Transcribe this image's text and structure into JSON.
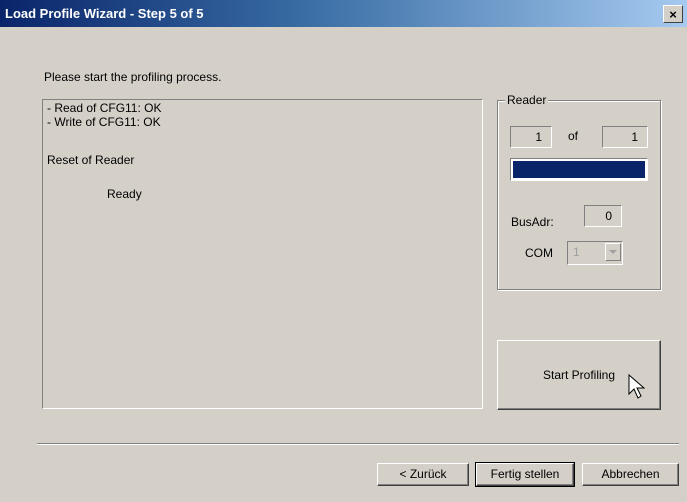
{
  "window": {
    "title": "Load Profile Wizard - Step 5 of 5",
    "close_glyph": "×"
  },
  "instruction": "Please start the profiling process.",
  "log": [
    "- Read of CFG11: OK",
    "- Write of CFG11: OK",
    "Reset of Reader",
    "Ready"
  ],
  "reader": {
    "label": "Reader",
    "current": "1",
    "of_label": "of",
    "total": "1",
    "progress_percent": 100,
    "busadr_label": "BusAdr:",
    "busadr_value": "0",
    "com_label": "COM",
    "com_value": "1"
  },
  "start_button": "Start Profiling",
  "footer": {
    "back": "< Zurück",
    "finish": "Fertig stellen",
    "cancel": "Abbrechen"
  },
  "colors": {
    "titlebar_start": "#0a246a",
    "titlebar_end": "#a6caf0",
    "progress_fill": "#0a246a"
  }
}
